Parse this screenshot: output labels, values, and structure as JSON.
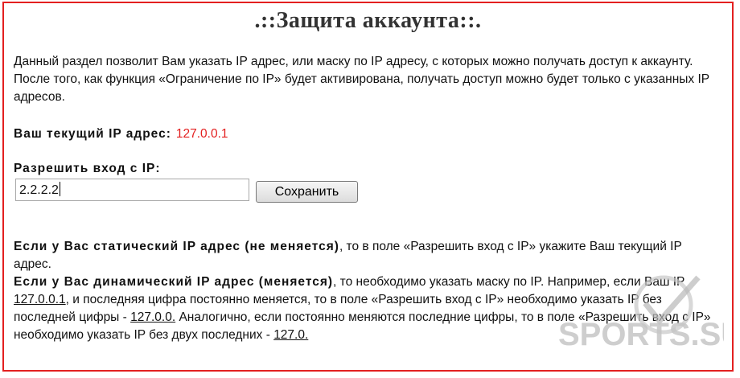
{
  "page": {
    "title": ".::Защита аккаунта::.",
    "intro": "Данный раздел позволит Вам указать IP адрес, или маску по IP адресу, с которых можно получать доступ к аккаунту. После того, как функция «Ограничение по IP» будет активирована, получать доступ можно будет только с указанных IP адресов.",
    "current_ip_label": "Ваш текущий IP адрес:",
    "current_ip_value": "127.0.0.1",
    "allow_label": "Разрешить вход с IP:",
    "ip_input_value": "2.2.2.2",
    "save_label": "Сохранить"
  },
  "info": {
    "static_bold": "Если у Вас статический IP адрес (не меняется)",
    "static_text": ", то в поле «Разрешить вход с IP» укажите Ваш текущий IP адрес.",
    "dynamic_bold": "Если у Вас динамический IP адрес (меняется)",
    "dynamic_text1": ", то необходимо указать маску по IP. Например, если Ваш IP ",
    "example_ip": "127.0.0.1",
    "dynamic_text2": ", и последняя цифра постоянно меняется, то в поле «Разрешить вход с IP» необходимо указать IP без последней цифры - ",
    "mask_one": "127.0.0.",
    "dynamic_text3": " Аналогично, если постоянно меняются последние цифры, то в поле «Разрешить вход с IP» необходимо указать IP без двух последних - ",
    "mask_two": "127.0."
  },
  "watermark": {
    "text": "SPORTS.SU"
  },
  "colors": {
    "border": "#e32020",
    "ip_value": "#e32020"
  }
}
